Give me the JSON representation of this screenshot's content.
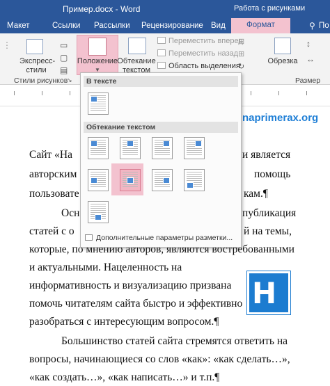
{
  "titlebar": {
    "title": "Пример.docx - Word",
    "context": "Работа с рисунками"
  },
  "tabs": [
    "Макет",
    "Ссылки",
    "Рассылки",
    "Рецензирование",
    "Вид",
    "Формат",
    "По"
  ],
  "ribbon": {
    "express_styles": "Экспресс-стили",
    "position": "Положение",
    "wrap_text": "Обтекание текстом",
    "bring_forward": "Переместить вперед",
    "send_backward": "Переместить назад",
    "selection_pane": "Область выделения",
    "crop": "Обрезка",
    "group_styles": "Стили рисунков",
    "group_size": "Размер"
  },
  "dropdown": {
    "section_inline": "В тексте",
    "section_wrap": "Обтекание текстом",
    "more": "Дополнительные параметры разметки..."
  },
  "document": {
    "site": "naprimerax.org",
    "lines": [
      "Сайт «На",
      "авторским",
      "пользовате",
      "Осн",
      "статей с о",
      "которые, по мнению авторов, являются востребованными",
      "и  актуальными.  Нацеленность  на",
      "информативность и визуализацию призвана",
      "помочь читателям сайта быстро и эффективно",
      "разобраться с интересующим вопросом.¶",
      "Большинство статей сайта стремятся ответить на",
      "вопросы, начинающиеся со слов «как»: «как сделать…»,",
      "«как создать…», «как написать…» и т.п.¶"
    ],
    "right_fragments": [
      "и является",
      "помощь",
      "кам.¶",
      "публикация",
      "й на темы,"
    ],
    "logo_text": "H"
  },
  "colors": {
    "accent": "#2b579a",
    "context": "#f3c2cf",
    "selected": "#f2b6c3",
    "site": "#1f7fd6"
  }
}
